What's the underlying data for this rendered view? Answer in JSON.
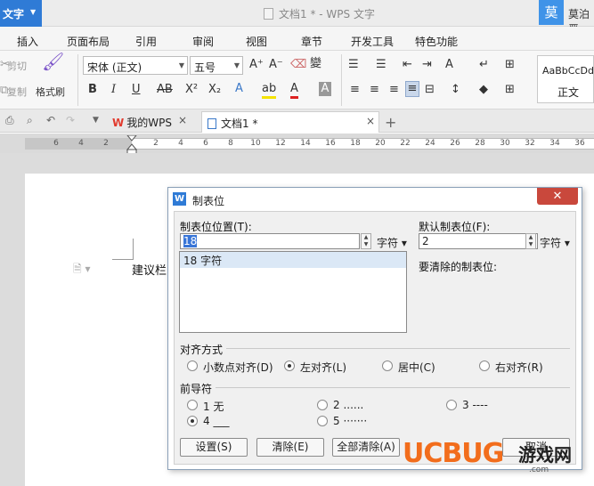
{
  "app": {
    "button_label": "文字",
    "window_title": "文档1 * - WPS 文字"
  },
  "user": {
    "avatar_char": "莫",
    "name": "莫泊晋"
  },
  "menu": {
    "items": [
      "插入",
      "页面布局",
      "引用",
      "审阅",
      "视图",
      "章节",
      "开发工具",
      "特色功能"
    ]
  },
  "ribbon": {
    "cut": "剪切",
    "copy": "复制",
    "format_painter": "格式刷",
    "font_name": "宋体 (正文)",
    "font_size": "五号",
    "style_preview": "AaBbCcDd",
    "style_name": "正文",
    "phonetic": "變"
  },
  "tabs": {
    "wps_tab": "我的WPS",
    "doc_tab": "文档1 *"
  },
  "ruler": {
    "labels": [
      "6",
      "4",
      "2",
      "2",
      "4",
      "6",
      "8",
      "10",
      "12",
      "14",
      "16",
      "18",
      "20",
      "22",
      "24",
      "26",
      "28",
      "30",
      "32",
      "34",
      "36"
    ]
  },
  "document": {
    "text": "建议栏"
  },
  "dialog": {
    "title": "制表位",
    "position_label": "制表位位置(T):",
    "position_value": "18",
    "unit": "字符",
    "list_items": [
      "18 字符"
    ],
    "default_label": "默认制表位(F):",
    "default_value": "2",
    "default_unit": "字符",
    "clear_label": "要清除的制表位:",
    "align_group": "对齐方式",
    "align_options": [
      {
        "label": "小数点对齐(D)",
        "checked": false
      },
      {
        "label": "左对齐(L)",
        "checked": true
      },
      {
        "label": "居中(C)",
        "checked": false
      },
      {
        "label": "右对齐(R)",
        "checked": false
      }
    ],
    "leader_group": "前导符",
    "leader_options": [
      {
        "label": "1 无",
        "checked": false
      },
      {
        "label": "2 ......",
        "checked": false
      },
      {
        "label": "3 ----",
        "checked": false
      },
      {
        "label": "4 ___",
        "checked": true
      },
      {
        "label": "5 ·······",
        "checked": false
      }
    ],
    "buttons": {
      "set": "设置(S)",
      "clear": "清除(E)",
      "clear_all": "全部清除(A)",
      "cancel": "取消"
    }
  },
  "watermark": {
    "brand": "UCBUG",
    "cn": "游戏网",
    "url": ".com"
  }
}
